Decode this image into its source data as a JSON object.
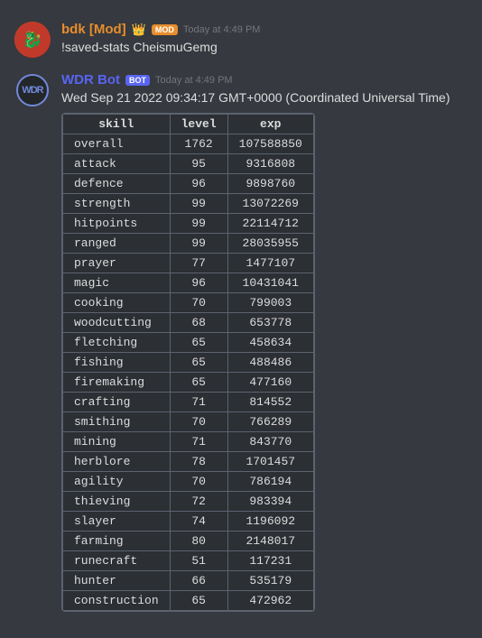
{
  "messages": [
    {
      "id": "bdk-message",
      "username": "bdk [Mod]",
      "username_color": "#e88d2d",
      "badge": "Mod",
      "has_crown": true,
      "timestamp": "Today at 4:49 PM",
      "text": "!saved-stats CheismuGemg"
    },
    {
      "id": "wdr-message",
      "username": "WDR Bot",
      "username_color": "#5865f2",
      "badge": "BOT",
      "timestamp": "Today at 4:49 PM",
      "subtitle": "Wed Sep 21 2022 09:34:17 GMT+0000 (Coordinated Universal Time)",
      "table": {
        "headers": [
          "skill",
          "level",
          "exp"
        ],
        "rows": [
          [
            "overall",
            "1762",
            "107588850"
          ],
          [
            "attack",
            "95",
            "9316808"
          ],
          [
            "defence",
            "96",
            "9898760"
          ],
          [
            "strength",
            "99",
            "13072269"
          ],
          [
            "hitpoints",
            "99",
            "22114712"
          ],
          [
            "ranged",
            "99",
            "28035955"
          ],
          [
            "prayer",
            "77",
            "1477107"
          ],
          [
            "magic",
            "96",
            "10431041"
          ],
          [
            "cooking",
            "70",
            "799003"
          ],
          [
            "woodcutting",
            "68",
            "653778"
          ],
          [
            "fletching",
            "65",
            "458634"
          ],
          [
            "fishing",
            "65",
            "488486"
          ],
          [
            "firemaking",
            "65",
            "477160"
          ],
          [
            "crafting",
            "71",
            "814552"
          ],
          [
            "smithing",
            "70",
            "766289"
          ],
          [
            "mining",
            "71",
            "843770"
          ],
          [
            "herblore",
            "78",
            "1701457"
          ],
          [
            "agility",
            "70",
            "786194"
          ],
          [
            "thieving",
            "72",
            "983394"
          ],
          [
            "slayer",
            "74",
            "1196092"
          ],
          [
            "farming",
            "80",
            "2148017"
          ],
          [
            "runecraft",
            "51",
            "117231"
          ],
          [
            "hunter",
            "66",
            "535179"
          ],
          [
            "construction",
            "65",
            "472962"
          ]
        ]
      }
    }
  ],
  "labels": {
    "mod": "Mod",
    "bot": "BOT"
  }
}
